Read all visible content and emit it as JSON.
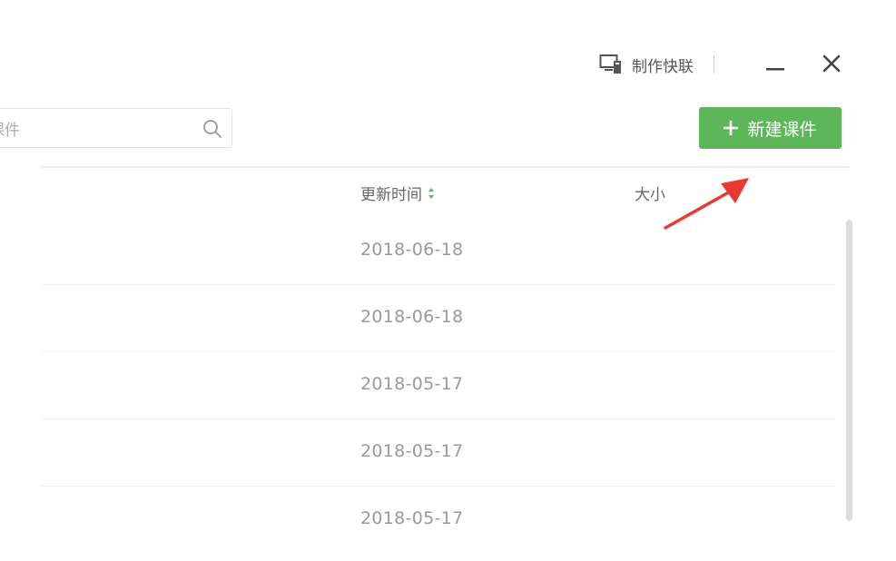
{
  "window": {
    "make_link_label": "制作快联",
    "minimize_icon": "minimize-icon",
    "close_icon": "close-icon",
    "monitor_icon": "monitor-icon"
  },
  "toolbar": {
    "search_value": "课件",
    "search_icon": "search-icon",
    "new_button_label": "新建课件",
    "new_button_color": "#5eb65a"
  },
  "table": {
    "columns": {
      "update_time": "更新时间",
      "size": "大小"
    },
    "rows": [
      {
        "date": "2018-06-18"
      },
      {
        "date": "2018-06-18"
      },
      {
        "date": "2018-05-17"
      },
      {
        "date": "2018-05-17"
      },
      {
        "date": "2018-05-17"
      }
    ]
  },
  "colors": {
    "accent_green": "#5eb65a",
    "annotation_red": "#e83a2f"
  }
}
